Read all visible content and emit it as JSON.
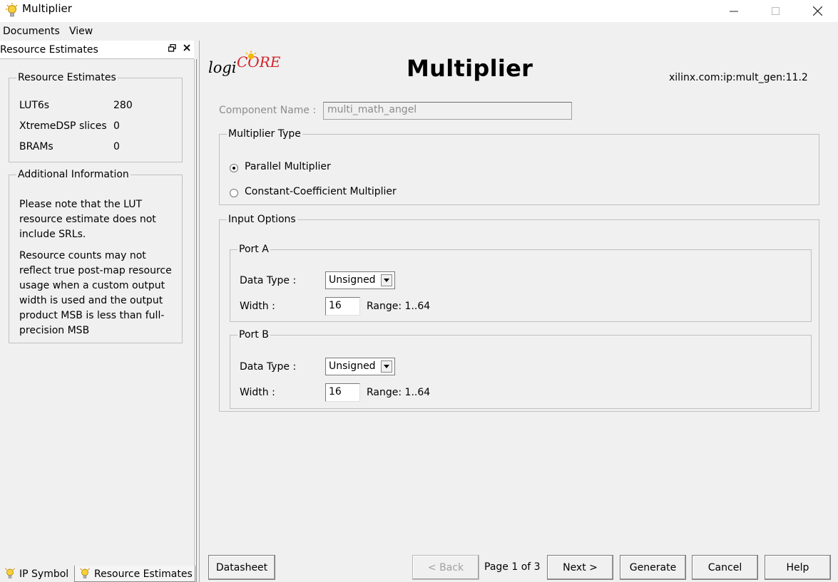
{
  "window": {
    "title": "Multiplier",
    "minimize_glyph": "—",
    "maximize_glyph": "☐",
    "close_glyph": "✕"
  },
  "menu": {
    "documents": "Documents",
    "view": "View"
  },
  "left_panel": {
    "header_title": "Resource Estimates",
    "float_glyph": "🗗",
    "close_glyph": "✕",
    "resource_group": {
      "title": "Resource Estimates",
      "rows": [
        {
          "label": "LUT6s",
          "value": "280"
        },
        {
          "label": "XtremeDSP slices",
          "value": "0"
        },
        {
          "label": "BRAMs",
          "value": "0"
        }
      ]
    },
    "additional_group": {
      "title": "Additional Information",
      "para1": "Please note that the LUT resource estimate does not include SRLs.",
      "para2": "Resource counts may not reflect true post-map resource usage when a custom output width is used and the output product MSB is less than full-precision MSB"
    },
    "tabs": {
      "ip_symbol": "IP Symbol",
      "resource_estimates": "Resource Estimates"
    }
  },
  "main": {
    "logo_text": {
      "a": "logi",
      "b": "CORE"
    },
    "page_title": "Multiplier",
    "ip_id": "xilinx.com:ip:mult_gen:11.2",
    "component_name_label": "Component Name :",
    "component_name_value": "multi_math_angel",
    "multiplier_type": {
      "title": "Multiplier Type",
      "options": [
        {
          "label": "Parallel Multiplier",
          "selected": true
        },
        {
          "label": "Constant-Coefficient Multiplier",
          "selected": false
        }
      ]
    },
    "input_options": {
      "title": "Input Options",
      "port_a": {
        "title": "Port A",
        "data_type_label": "Data Type :",
        "data_type_value": "Unsigned",
        "width_label": "Width :",
        "width_value": "16",
        "range": "Range: 1..64"
      },
      "port_b": {
        "title": "Port B",
        "data_type_label": "Data Type :",
        "data_type_value": "Unsigned",
        "width_label": "Width :",
        "width_value": "16",
        "range": "Range: 1..64"
      }
    },
    "buttons": {
      "datasheet": "Datasheet",
      "back": "< Back",
      "page_info": "Page 1 of 3",
      "next": "Next >",
      "generate": "Generate",
      "cancel": "Cancel",
      "help": "Help"
    }
  },
  "colors": {
    "window_bg": "#f0f0f0",
    "titlebar_bg": "#ffffff",
    "disabled_text": "#8c8c8c",
    "logo_yellow": "#f5b800",
    "logo_red": "#d2232a"
  },
  "icons": {
    "app": "lightbulb-icon",
    "tab_bulb": "lightbulb-icon"
  }
}
